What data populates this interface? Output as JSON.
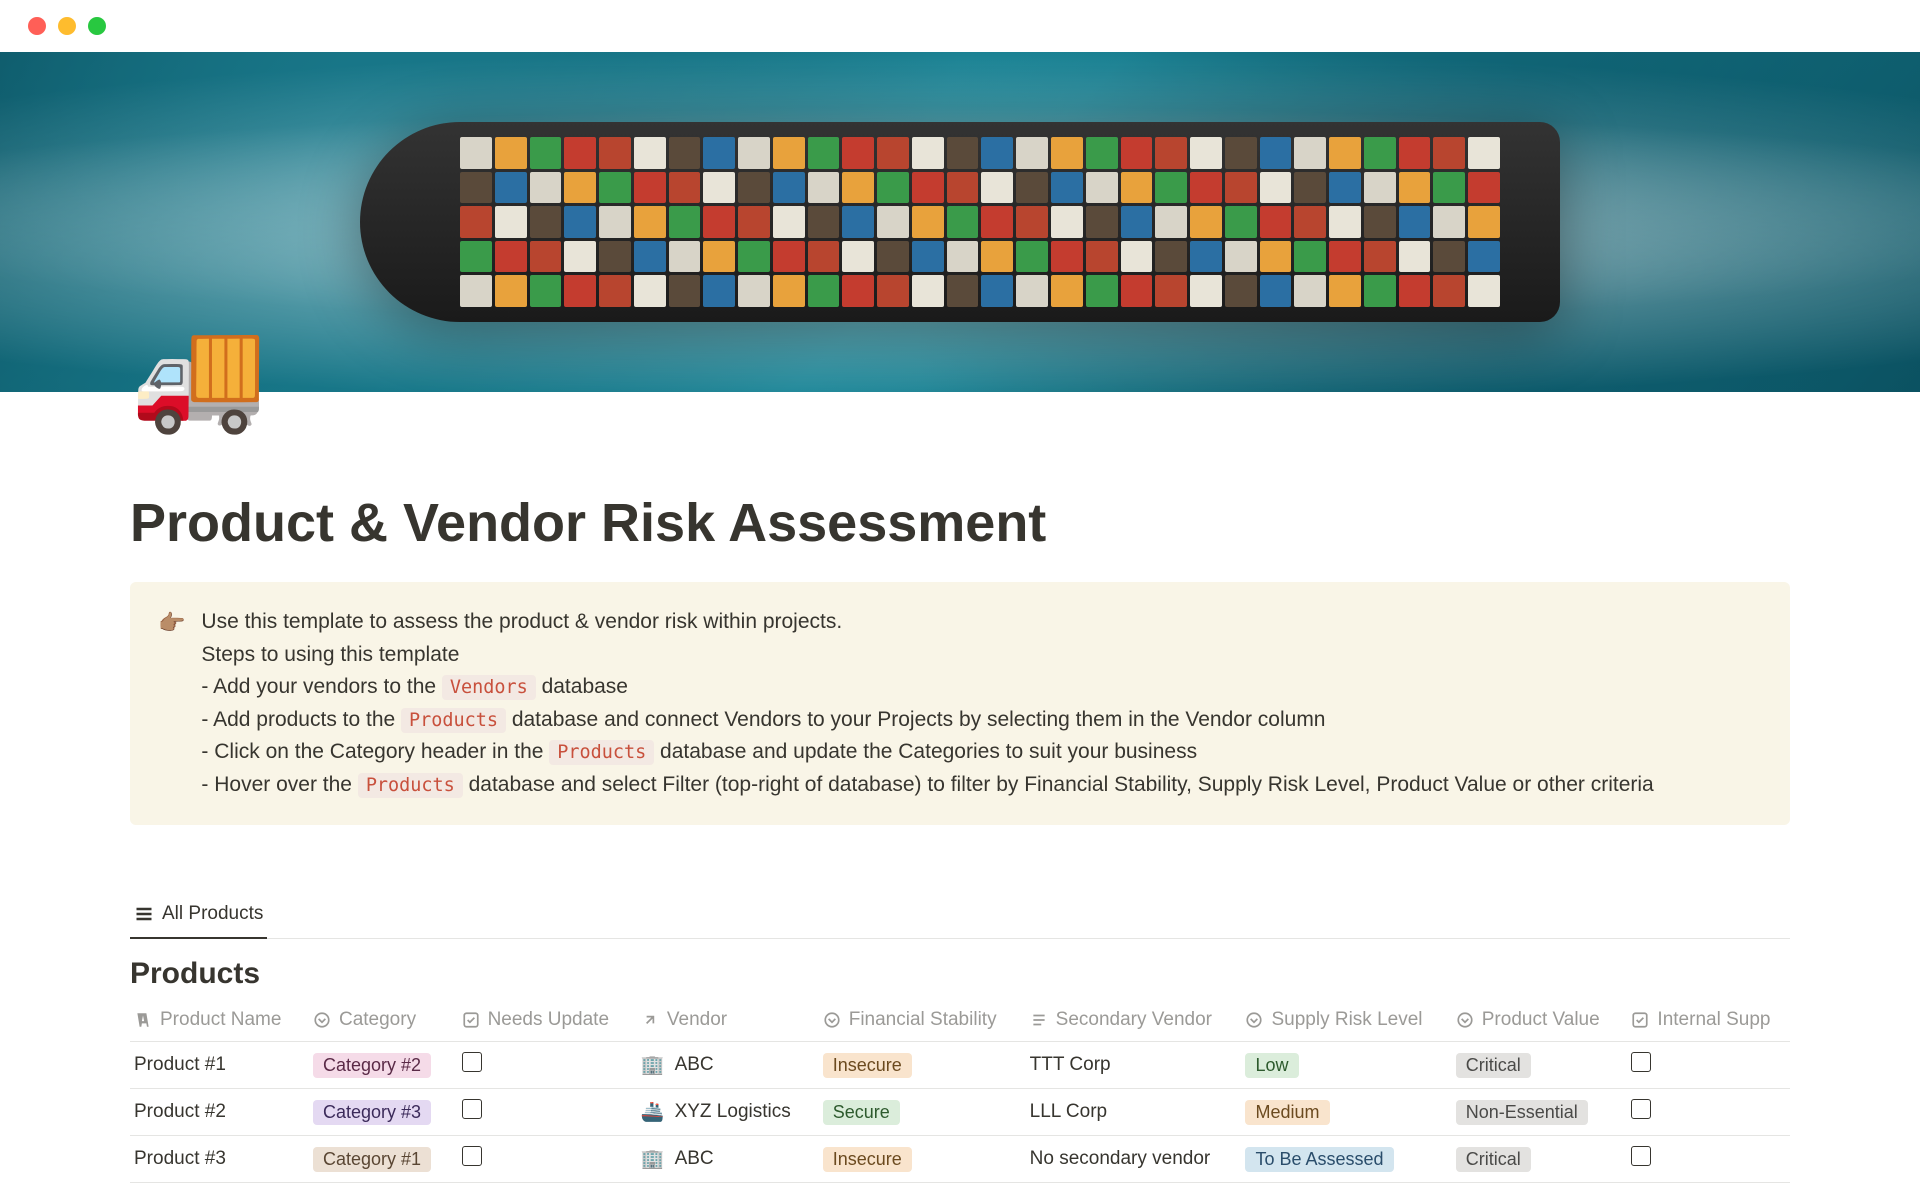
{
  "page": {
    "icon": "🚚",
    "title": "Product & Vendor Risk Assessment"
  },
  "callout": {
    "icon": "👉🏽",
    "intro": "Use this template to assess the product & vendor risk within projects.",
    "steps_heading": "Steps to using this template",
    "step1_prefix": "- Add your vendors to the ",
    "step1_code": "Vendors",
    "step1_suffix": " database",
    "step2_prefix": "- Add products to the ",
    "step2_code": "Products",
    "step2_suffix": " database and connect Vendors to your Projects by selecting them in the Vendor column",
    "step3_prefix": "- Click on the Category header in the ",
    "step3_code": "Products",
    "step3_suffix": " database and update the Categories to suit your business",
    "step4_prefix": "- Hover over the ",
    "step4_code": "Products",
    "step4_suffix": " database and select Filter (top-right of database) to filter by Financial Stability, Supply Risk Level, Product Value or other criteria"
  },
  "view": {
    "tab_label": "All Products",
    "db_title": "Products"
  },
  "columns": {
    "name": "Product Name",
    "category": "Category",
    "needs_update": "Needs Update",
    "vendor": "Vendor",
    "fin_stability": "Financial Stability",
    "secondary_vendor": "Secondary Vendor",
    "supply_risk": "Supply Risk Level",
    "product_value": "Product Value",
    "internal_supp": "Internal Supp"
  },
  "rows": [
    {
      "name": "Product #1",
      "category": {
        "label": "Category #2",
        "class": "tag-pink"
      },
      "needs_update": false,
      "vendor": {
        "emoji": "🏢",
        "label": "ABC"
      },
      "fin_stability": {
        "label": "Insecure",
        "class": "tag-orange"
      },
      "secondary_vendor": "TTT Corp",
      "supply_risk": {
        "label": "Low",
        "class": "tag-green"
      },
      "product_value": {
        "label": "Critical",
        "class": "tag-gray"
      },
      "internal_supp": false
    },
    {
      "name": "Product #2",
      "category": {
        "label": "Category #3",
        "class": "tag-purple"
      },
      "needs_update": false,
      "vendor": {
        "emoji": "🚢",
        "label": "XYZ Logistics"
      },
      "fin_stability": {
        "label": "Secure",
        "class": "tag-green"
      },
      "secondary_vendor": "LLL Corp",
      "supply_risk": {
        "label": "Medium",
        "class": "tag-orange"
      },
      "product_value": {
        "label": "Non-Essential",
        "class": "tag-gray"
      },
      "internal_supp": false
    },
    {
      "name": "Product #3",
      "category": {
        "label": "Category #1",
        "class": "tag-brown-light"
      },
      "needs_update": false,
      "vendor": {
        "emoji": "🏢",
        "label": "ABC"
      },
      "fin_stability": {
        "label": "Insecure",
        "class": "tag-orange"
      },
      "secondary_vendor": "No secondary vendor",
      "supply_risk": {
        "label": "To Be Assessed",
        "class": "tag-blue"
      },
      "product_value": {
        "label": "Critical",
        "class": "tag-gray"
      },
      "internal_supp": false
    }
  ]
}
